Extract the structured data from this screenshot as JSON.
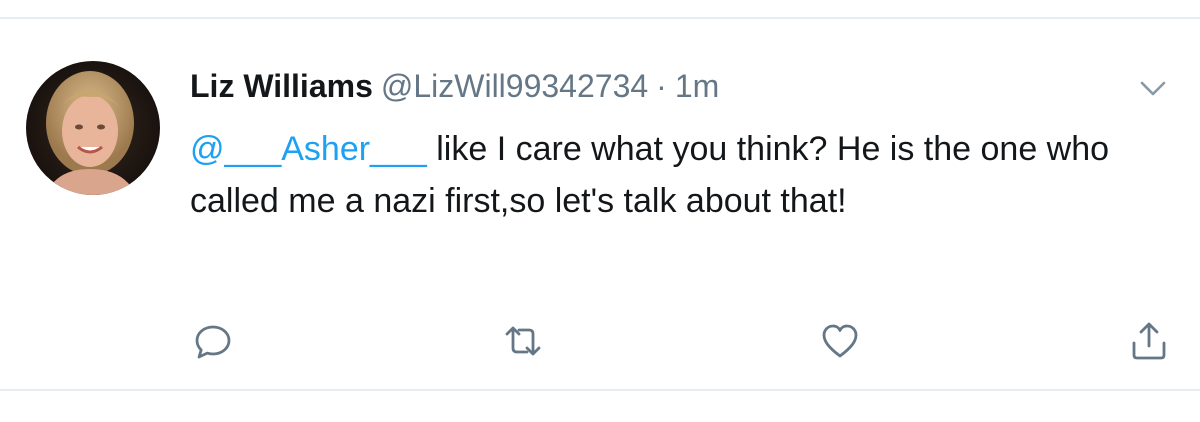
{
  "tweet": {
    "display_name": "Liz Williams",
    "handle": "@LizWill99342734",
    "separator": "·",
    "time": "1m",
    "mention": "@___Asher___",
    "text": " like I care what you think? He is the one who called me a nazi first,so let's talk about that!"
  },
  "icons": {
    "caret": "chevron-down-icon",
    "reply": "comment-bubble-icon",
    "retweet": "retweet-icon",
    "like": "heart-icon",
    "share": "share-upload-icon"
  },
  "colors": {
    "text": "#14171a",
    "secondary": "#657786",
    "mention": "#1da1f2",
    "divider": "#e6ecf0"
  }
}
